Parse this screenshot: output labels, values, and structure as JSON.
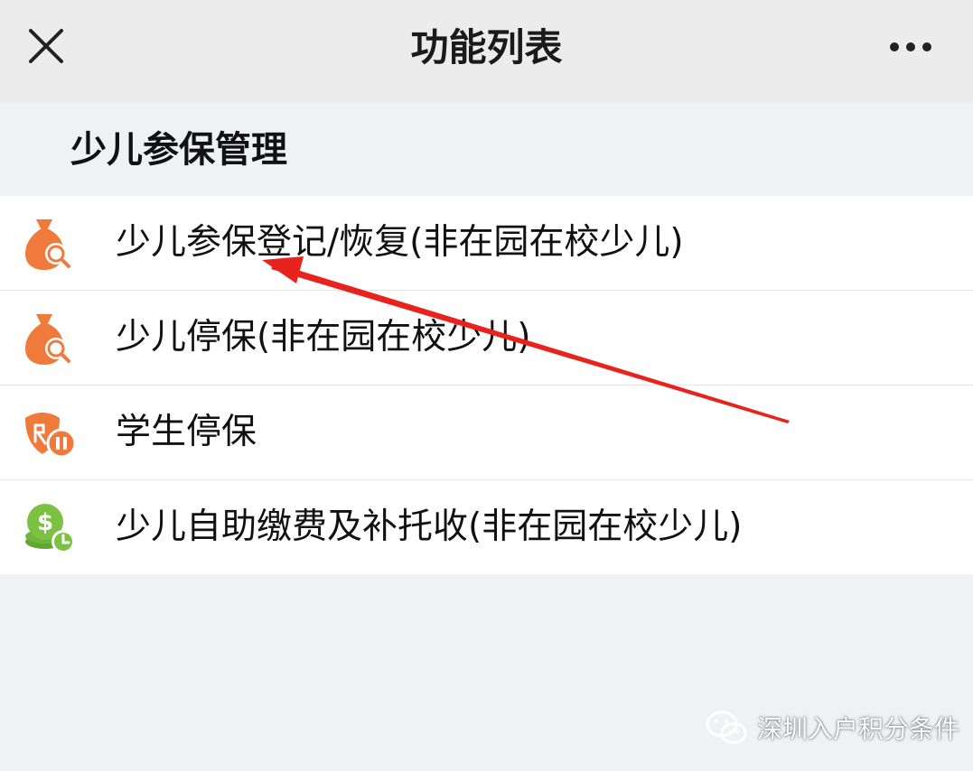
{
  "header": {
    "title": "功能列表",
    "close_icon": "close-icon",
    "more_icon": "more-dots-icon"
  },
  "section": {
    "title": "少儿参保管理"
  },
  "items": [
    {
      "label": "少儿参保登记/恢复(非在园在校少儿)",
      "icon": "money-bag-search-icon",
      "icon_color": "#f07a3c"
    },
    {
      "label": "少儿停保(非在园在校少儿)",
      "icon": "money-bag-search-icon",
      "icon_color": "#f07a3c"
    },
    {
      "label": "学生停保",
      "icon": "insurance-pause-icon",
      "icon_color": "#f07a3c"
    },
    {
      "label": "少儿自助缴费及补托收(非在园在校少儿)",
      "icon": "coin-clock-icon",
      "icon_color": "#7cc142"
    }
  ],
  "annotation": {
    "arrow_color": "#e8221c"
  },
  "watermark": {
    "text": "深圳入户积分条件",
    "icon": "wechat-icon"
  },
  "colors": {
    "topbar_bg": "#ececec",
    "page_bg": "#eff1f4",
    "item_bg": "#ffffff"
  }
}
